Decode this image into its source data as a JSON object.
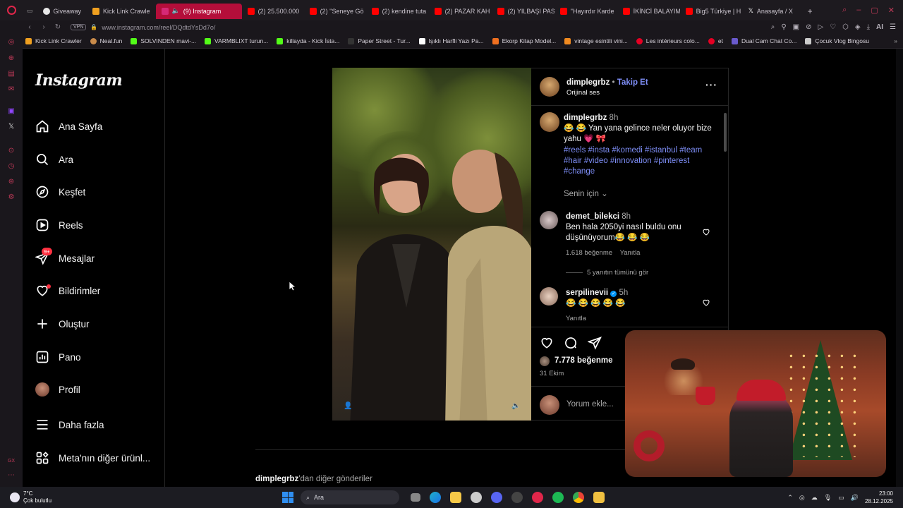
{
  "browser": {
    "tabs": [
      {
        "label": "Giveaway",
        "color": "#e8e8e8",
        "active": false
      },
      {
        "label": "Kick Link Crawle",
        "color": "#f0a020",
        "active": false
      },
      {
        "label": "(9) Instagram",
        "color": "#d62976",
        "active": true
      },
      {
        "label": "(2) 25.500.000",
        "color": "#ff0000",
        "active": false
      },
      {
        "label": "(2) ''Seneye Gö",
        "color": "#ff0000",
        "active": false
      },
      {
        "label": "(2) kendine tuta",
        "color": "#ff0000",
        "active": false
      },
      {
        "label": "(2) PAZAR KAH",
        "color": "#ff0000",
        "active": false
      },
      {
        "label": "(2) YILBAŞI PAS",
        "color": "#ff0000",
        "active": false
      },
      {
        "label": "''Hayırdır Karde",
        "color": "#ff0000",
        "active": false
      },
      {
        "label": "İKİNCİ BALAYIM",
        "color": "#ff0000",
        "active": false
      },
      {
        "label": "Big5 Türkiye | H",
        "color": "#ff0000",
        "active": false
      },
      {
        "label": "Anasayfa / X",
        "color": "#ffffff",
        "active": false
      }
    ],
    "url": "www.instagram.com/reel/DQdtdYsDd7o/",
    "vpn_label": "VPN",
    "ai_label": "AI",
    "bookmarks": [
      {
        "label": "Kick Link Crawler",
        "color": "#f0a020"
      },
      {
        "label": "Neal.fun",
        "color": "#c98b4a"
      },
      {
        "label": "SOLVINDEN mavi-...",
        "color": "#53fc18"
      },
      {
        "label": "VARMBLIXT turun...",
        "color": "#53fc18"
      },
      {
        "label": "killayda - Kick İsta...",
        "color": "#53fc18"
      },
      {
        "label": "Paper Street - Tur...",
        "color": "#333333"
      },
      {
        "label": "Işıklı Harfli Yazı Pa...",
        "color": "#ffffff"
      },
      {
        "label": "Ekorp Kitap Model...",
        "color": "#f07020"
      },
      {
        "label": "vintage esintili vini...",
        "color": "#f08a20"
      },
      {
        "label": "Les intérieurs colo...",
        "color": "#e60023"
      },
      {
        "label": "et",
        "color": "#e60023"
      },
      {
        "label": "Dual Cam Chat Co...",
        "color": "#6a5acd"
      },
      {
        "label": "Çocuk Vlog Bingosu",
        "color": "#cccccc"
      }
    ]
  },
  "nav": {
    "logo": "Instagram",
    "items": [
      {
        "label": "Ana Sayfa",
        "icon": "home-icon"
      },
      {
        "label": "Ara",
        "icon": "search-icon"
      },
      {
        "label": "Keşfet",
        "icon": "compass-icon"
      },
      {
        "label": "Reels",
        "icon": "reels-icon"
      },
      {
        "label": "Mesajlar",
        "icon": "messages-icon",
        "badge": "9+"
      },
      {
        "label": "Bildirimler",
        "icon": "heart-icon"
      },
      {
        "label": "Oluştur",
        "icon": "plus-icon"
      },
      {
        "label": "Pano",
        "icon": "dashboard-icon"
      },
      {
        "label": "Profil",
        "icon": "avatar"
      },
      {
        "label": "Daha fazla",
        "icon": "menu-icon"
      },
      {
        "label": "Meta'nın diğer ürünl...",
        "icon": "meta-apps-icon"
      }
    ]
  },
  "post": {
    "username": "dimplegrbz",
    "separator": "•",
    "follow_label": "Takip Et",
    "audio": "Orijinal ses",
    "caption_user": "dimplegrbz",
    "caption_time": "8h",
    "caption_text": "😂 😂 Yan yana gelince neler oluyor bize yahu 💗 🎀",
    "hashtags": "#reels #insta #komedi #istanbul #team #hair #video #innovation #pinterest #change",
    "for_you": "Senin için",
    "comments": [
      {
        "user": "demet_bilekci",
        "time": "8h",
        "text": "Ben hala 2050yi nasıl buldu onu düşünüyorum😂 😂 😂",
        "likes": "1.618 beğenme",
        "reply": "Yanıtla",
        "view_replies": "5 yanıtın tümünü gör"
      },
      {
        "user": "serpilinevii",
        "time": "5h",
        "text": "😂 😂 😂 😂 😂",
        "reply": "Yanıtla",
        "verified": true
      }
    ],
    "likes": "7.778 beğenme",
    "date": "31 Ekim",
    "comment_placeholder": "Yorum ekle..."
  },
  "more_posts": {
    "user": "dimplegrbz",
    "suffix": "'dan diğer gönderiler"
  },
  "taskbar": {
    "temperature": "7°C",
    "weather": "Çok bulutlu",
    "search_placeholder": "Ara",
    "time": "23:00",
    "date": "28.12.2025"
  }
}
